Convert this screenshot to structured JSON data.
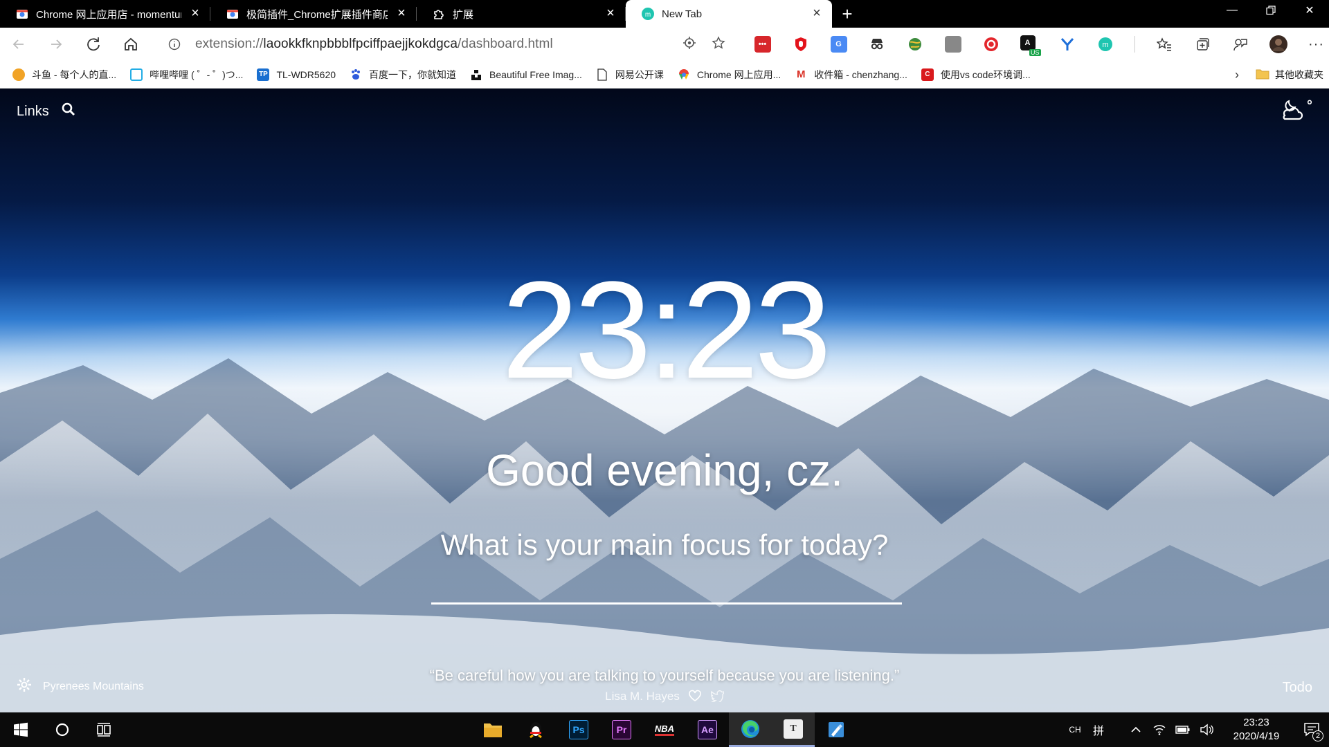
{
  "tabs": [
    {
      "title": "Chrome 网上应用店 - momentum",
      "active": false
    },
    {
      "title": "极简插件_Chrome扩展插件商店_",
      "active": false
    },
    {
      "title": "扩展",
      "active": false
    },
    {
      "title": "New Tab",
      "active": true
    }
  ],
  "toolbar": {
    "url_prefix": "extension://",
    "url_host": "laookkfknpbbblfpciffpaejjkokdgca",
    "url_path": "/dashboard.html",
    "ext_badge_us": "US"
  },
  "bookmarks": [
    {
      "label": "斗鱼 - 每个人的直...",
      "color": "#f1a326"
    },
    {
      "label": "哔哩哔哩 ( ゜- ゜)つ...",
      "color": "#23ade5"
    },
    {
      "label": "TL-WDR5620",
      "color": "#1a6fd0",
      "glyph": "TP"
    },
    {
      "label": "百度一下，你就知道",
      "color": "#2f5bdb"
    },
    {
      "label": "Beautiful Free Imag...",
      "color": "#111111"
    },
    {
      "label": "网易公开课",
      "color": "#ffffff"
    },
    {
      "label": "Chrome 网上应用...",
      "color": "#e8b034"
    },
    {
      "label": "收件箱 - chenzhang...",
      "color": "#d93025",
      "glyph": "M"
    },
    {
      "label": "使用vs code环境调...",
      "color": "#d9191c",
      "glyph": "C"
    }
  ],
  "bookmarks_other": "其他收藏夹",
  "dashboard": {
    "links_label": "Links",
    "clock": "23:23",
    "greeting": "Good evening, cz.",
    "focus_question": "What is your main focus for today?",
    "location": "Pyrenees Mountains",
    "quote": "“Be careful how you are talking to yourself because you are listening.”",
    "quote_author": "Lisa M. Hayes",
    "todo_label": "Todo",
    "weather_temp": "°"
  },
  "taskbar": {
    "time": "23:23",
    "date": "2020/4/19",
    "lang": "CH",
    "ime": "拼",
    "notif_count": "2",
    "apps": [
      {
        "name": "File Explorer",
        "label": "",
        "bg": "#e8b637",
        "fg": "#fff"
      },
      {
        "name": "QQ",
        "label": "",
        "bg": "transparent",
        "fg": "#fff"
      },
      {
        "name": "Photoshop",
        "label": "Ps",
        "bg": "#001d34",
        "fg": "#31a8ff"
      },
      {
        "name": "Premiere",
        "label": "Pr",
        "bg": "#2a0634",
        "fg": "#e77cff"
      },
      {
        "name": "NBA 2K19",
        "label": "NBA",
        "bg": "transparent",
        "fg": "#fff"
      },
      {
        "name": "After Effects",
        "label": "Ae",
        "bg": "#1f0a3d",
        "fg": "#d59eff"
      },
      {
        "name": "Edge",
        "label": "",
        "bg": "transparent",
        "fg": "#fff"
      },
      {
        "name": "Typora",
        "label": "T",
        "bg": "#eeeeee",
        "fg": "#333"
      },
      {
        "name": "Paint",
        "label": "",
        "bg": "#3a8ed9",
        "fg": "#fff"
      }
    ]
  }
}
